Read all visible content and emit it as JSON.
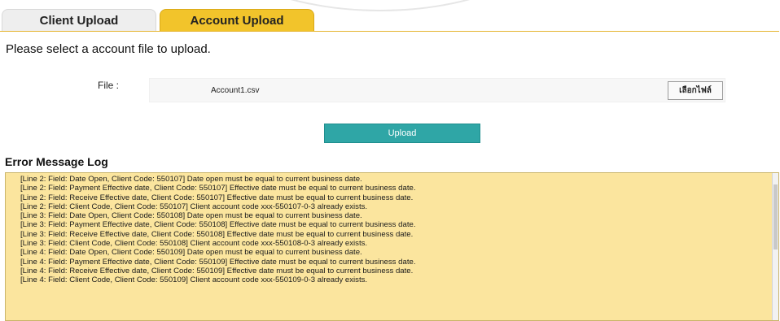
{
  "tabs": [
    {
      "label": "Client Upload"
    },
    {
      "label": "Account Upload"
    }
  ],
  "form": {
    "prompt": "Please select a account file to upload.",
    "file_label": "File :",
    "file_name": "Account1.csv",
    "browse_label": "เลือกไฟล์",
    "upload_label": "Upload"
  },
  "log": {
    "title": "Error Message Log",
    "lines": [
      "[Line 2: Field: Date Open, Client Code: 550107] Date open must be equal to current business date.",
      "[Line 2: Field: Payment Effective date, Client Code: 550107] Effective date must be equal to current business date.",
      "[Line 2: Field: Receive Effective date, Client Code: 550107] Effective date must be equal to current business date.",
      "[Line 2: Field: Client Code, Client Code: 550107] Client account code xxx-550107-0-3 already exists.",
      "[Line 3: Field: Date Open, Client Code: 550108] Date open must be equal to current business date.",
      "[Line 3: Field: Payment Effective date, Client Code: 550108] Effective date must be equal to current business date.",
      "[Line 3: Field: Receive Effective date, Client Code: 550108] Effective date must be equal to current business date.",
      "[Line 3: Field: Client Code, Client Code: 550108] Client account code xxx-550108-0-3 already exists.",
      "[Line 4: Field: Date Open, Client Code: 550109] Date open must be equal to current business date.",
      "[Line 4: Field: Payment Effective date, Client Code: 550109] Effective date must be equal to current business date.",
      "[Line 4: Field: Receive Effective date, Client Code: 550109] Effective date must be equal to current business date.",
      "[Line 4: Field: Client Code, Client Code: 550109] Client account code xxx-550109-0-3 already exists."
    ]
  }
}
